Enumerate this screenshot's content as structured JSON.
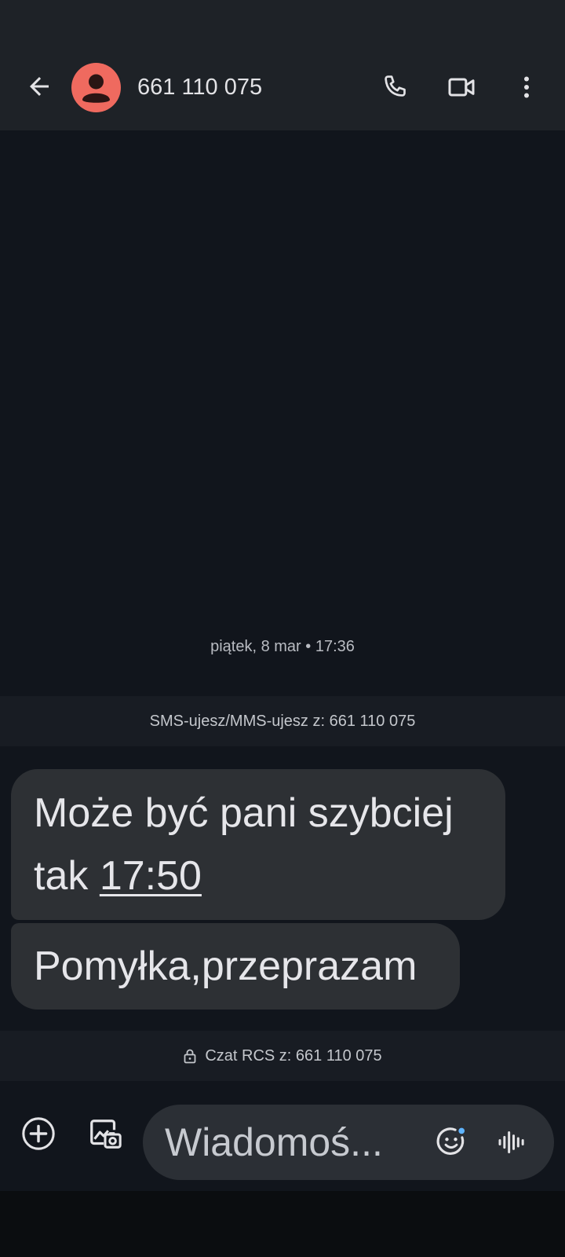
{
  "header": {
    "contact_title": "661 110 075"
  },
  "icons": {
    "back": "arrow-back-icon",
    "avatar": "person-icon",
    "call": "phone-icon",
    "video": "video-camera-icon",
    "more": "more-vert-icon",
    "lock": "lock-icon",
    "add": "add-circle-icon",
    "gallery": "gallery-camera-icon",
    "emoji": "emoji-icon",
    "voice": "voice-waveform-icon"
  },
  "colors": {
    "avatar_bg": "#ef6a5f",
    "bubble_bg": "#2d3034",
    "app_bar_bg": "#1e2227",
    "background": "#11151c",
    "emoji_dot": "#5fb4ff"
  },
  "conversation": {
    "date_separator": "piątek, 8 mar • 17:36",
    "sms_banner": "SMS-ujesz/MMS-ujesz z: 661 110 075",
    "messages": [
      {
        "text_before": "Może być pani szybciej tak ",
        "link_text": "17:50"
      },
      {
        "text": "Pomyłka,przeprazam"
      }
    ],
    "rcs_banner": "Czat RCS z: 661 110 075"
  },
  "compose": {
    "placeholder": "Wiadomoś..."
  }
}
